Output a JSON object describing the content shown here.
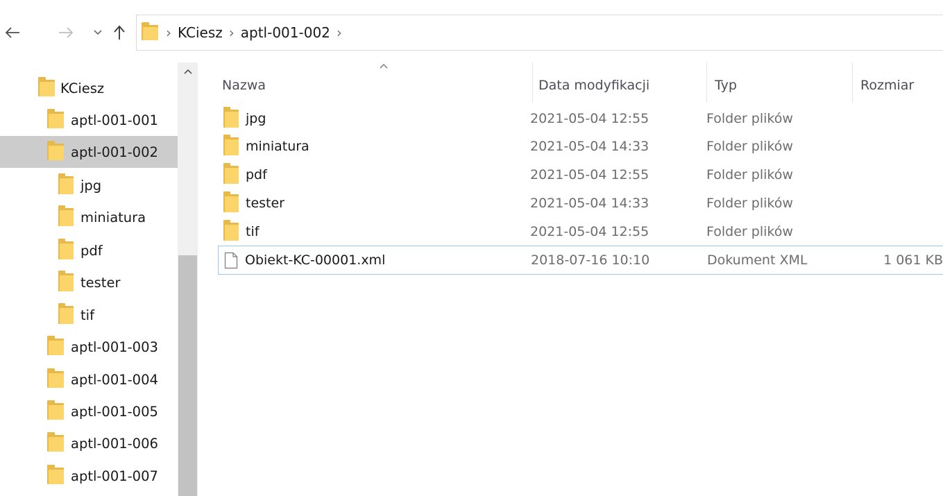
{
  "nav": {
    "back_icon": "back-arrow-icon",
    "forward_icon": "forward-arrow-icon",
    "recent_icon": "chevron-down-icon",
    "up_icon": "up-arrow-icon"
  },
  "address": {
    "separator": "›",
    "crumbs": [
      "KCiesz",
      "aptl-001-002"
    ]
  },
  "sidebar": {
    "items": [
      {
        "label": "KCiesz",
        "level": 0,
        "selected": false
      },
      {
        "label": "aptl-001-001",
        "level": 1,
        "selected": false
      },
      {
        "label": "aptl-001-002",
        "level": 1,
        "selected": true
      },
      {
        "label": "jpg",
        "level": 2,
        "selected": false
      },
      {
        "label": "miniatura",
        "level": 2,
        "selected": false
      },
      {
        "label": "pdf",
        "level": 2,
        "selected": false
      },
      {
        "label": "tester",
        "level": 2,
        "selected": false
      },
      {
        "label": "tif",
        "level": 2,
        "selected": false
      },
      {
        "label": "aptl-001-003",
        "level": 1,
        "selected": false
      },
      {
        "label": "aptl-001-004",
        "level": 1,
        "selected": false
      },
      {
        "label": "aptl-001-005",
        "level": 1,
        "selected": false
      },
      {
        "label": "aptl-001-006",
        "level": 1,
        "selected": false
      },
      {
        "label": "aptl-001-007",
        "level": 1,
        "selected": false
      }
    ]
  },
  "list": {
    "columns": {
      "name": "Nazwa",
      "date": "Data modyfikacji",
      "type": "Typ",
      "size": "Rozmiar"
    },
    "rows": [
      {
        "name": "jpg",
        "date": "2021-05-04 12:55",
        "type": "Folder plików",
        "size": "",
        "icon": "folder-icon"
      },
      {
        "name": "miniatura",
        "date": "2021-05-04 14:33",
        "type": "Folder plików",
        "size": "",
        "icon": "folder-icon"
      },
      {
        "name": "pdf",
        "date": "2021-05-04 12:55",
        "type": "Folder plików",
        "size": "",
        "icon": "folder-icon"
      },
      {
        "name": "tester",
        "date": "2021-05-04 14:33",
        "type": "Folder plików",
        "size": "",
        "icon": "folder-icon"
      },
      {
        "name": "tif",
        "date": "2021-05-04 12:55",
        "type": "Folder plików",
        "size": "",
        "icon": "folder-icon"
      },
      {
        "name": "Obiekt-KC-00001.xml",
        "date": "2018-07-16 10:10",
        "type": "Dokument XML",
        "size": "1 061 KB",
        "icon": "document-icon",
        "focused": true
      }
    ]
  },
  "colors": {
    "folder_front": "#fcd56a",
    "folder_back": "#e6b94a",
    "selection": "#cccccc",
    "focus_border": "#99c9ef"
  }
}
